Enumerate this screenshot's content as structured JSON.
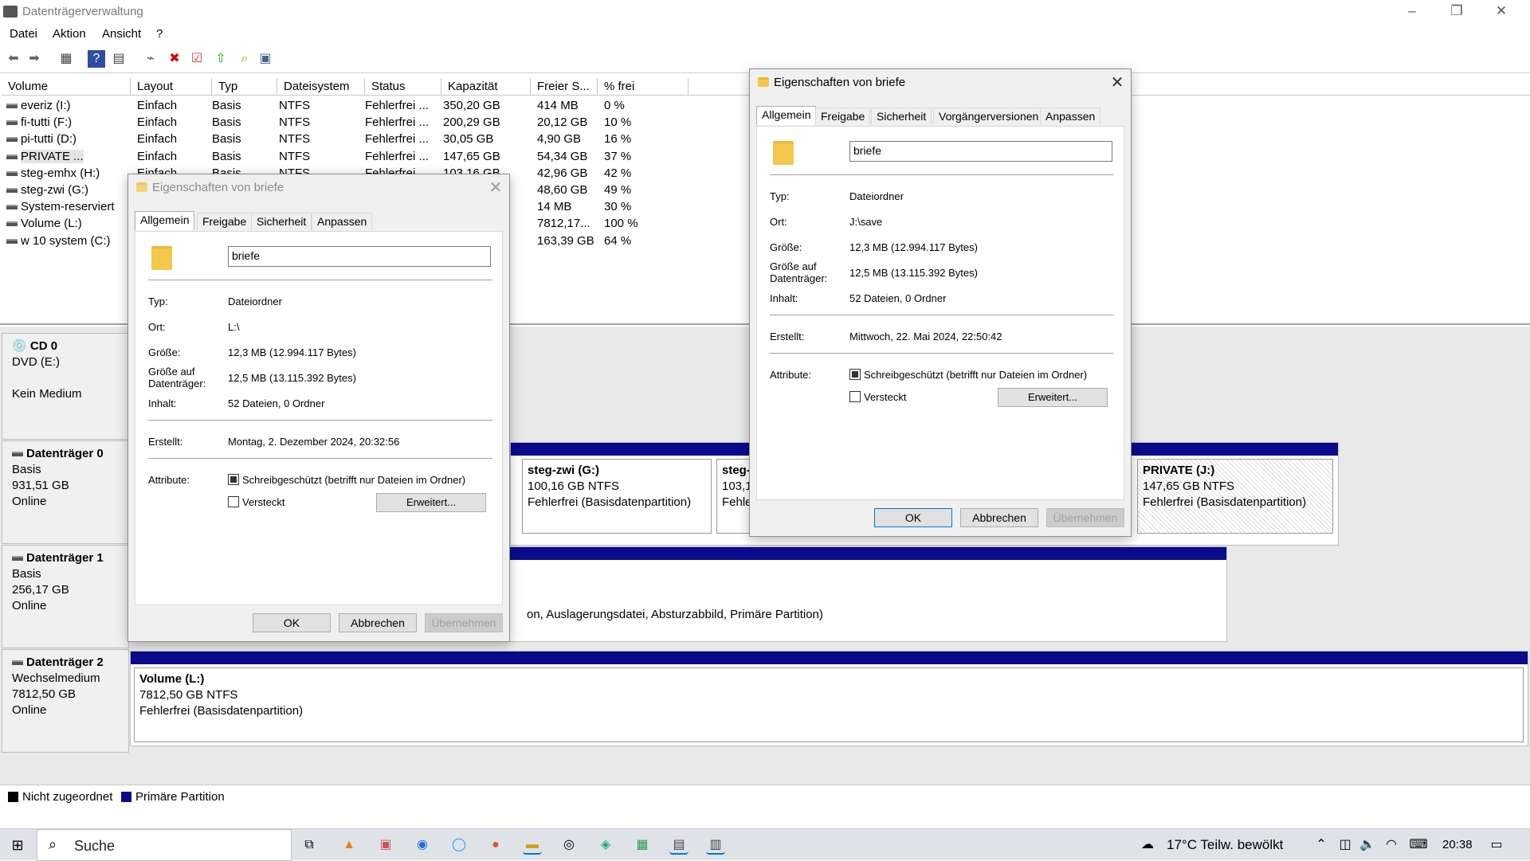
{
  "window": {
    "title": "Datenträgerverwaltung",
    "minimize_icon": "minimize-icon",
    "maximize_icon": "restore-icon",
    "close_icon": "close-icon"
  },
  "menu": [
    "Datei",
    "Aktion",
    "Ansicht",
    "?"
  ],
  "table": {
    "headers": [
      "Volume",
      "Layout",
      "Typ",
      "Dateisystem",
      "Status",
      "Kapazität",
      "Freier S...",
      "% frei"
    ],
    "rows": [
      {
        "volume": "everiz (I:)",
        "layout": "Einfach",
        "typ": "Basis",
        "fs": "NTFS",
        "status": "Fehlerfrei ...",
        "cap": "350,20 GB",
        "free": "414 MB",
        "pct": "0 %"
      },
      {
        "volume": "fi-tutti (F:)",
        "layout": "Einfach",
        "typ": "Basis",
        "fs": "NTFS",
        "status": "Fehlerfrei ...",
        "cap": "200,29 GB",
        "free": "20,12 GB",
        "pct": "10 %"
      },
      {
        "volume": "pi-tutti (D:)",
        "layout": "Einfach",
        "typ": "Basis",
        "fs": "NTFS",
        "status": "Fehlerfrei ...",
        "cap": "30,05 GB",
        "free": "4,90 GB",
        "pct": "16 %"
      },
      {
        "volume": "PRIVATE ...",
        "layout": "Einfach",
        "typ": "Basis",
        "fs": "NTFS",
        "status": "Fehlerfrei ...",
        "cap": "147,65 GB",
        "free": "54,34 GB",
        "pct": "37 %"
      },
      {
        "volume": "steg-emhx (H:)",
        "layout": "Einfach",
        "typ": "Basis",
        "fs": "NTFS",
        "status": "Fehlerfrei ...",
        "cap": "103,16 GB",
        "free": "42,96 GB",
        "pct": "42 %"
      },
      {
        "volume": "steg-zwi (G:)",
        "layout": "",
        "typ": "",
        "fs": "",
        "status": "",
        "cap": "",
        "free": "48,60 GB",
        "pct": "49 %"
      },
      {
        "volume": "System-reserviert",
        "layout": "",
        "typ": "",
        "fs": "",
        "status": "",
        "cap": "",
        "free": "14 MB",
        "pct": "30 %"
      },
      {
        "volume": "Volume (L:)",
        "layout": "",
        "typ": "",
        "fs": "",
        "status": "",
        "cap": "",
        "free": "7812,17...",
        "pct": "100 %"
      },
      {
        "volume": "w 10 system (C:)",
        "layout": "",
        "typ": "",
        "fs": "",
        "status": "",
        "cap": "",
        "free": "163,39 GB",
        "pct": "64 %"
      }
    ]
  },
  "disks": [
    {
      "name": "CD 0",
      "line1": "DVD (E:)",
      "line2": "",
      "line3": "Kein Medium"
    },
    {
      "name": "Datenträger 0",
      "line1": "Basis",
      "line2": "931,51 GB",
      "line3": "Online"
    },
    {
      "name": "Datenträger 1",
      "line1": "Basis",
      "line2": "256,17 GB",
      "line3": "Online"
    },
    {
      "name": "Datenträger 2",
      "line1": "Wechselmedium",
      "line2": "7812,50 GB",
      "line3": "Online"
    }
  ],
  "partitions": {
    "g": {
      "title": "steg-zwi  (G:)",
      "size": "100,16 GB NTFS",
      "status": "Fehlerfrei (Basisdatenpartition)"
    },
    "h": {
      "title": "steg-",
      "size": "103,1",
      "status": "Fehle"
    },
    "j": {
      "title": "PRIVATE  (J:)",
      "size": "147,65 GB NTFS",
      "status": "Fehlerfrei (Basisdatenpartition)"
    },
    "disk1_text": "on, Auslagerungsdatei, Absturzabbild, Primäre Partition)",
    "l": {
      "title": "Volume  (L:)",
      "size": "7812,50 GB NTFS",
      "status": "Fehlerfrei (Basisdatenpartition)"
    }
  },
  "legend": {
    "unallocated": "Nicht zugeordnet",
    "primary": "Primäre Partition",
    "unallocated_color": "#000000",
    "primary_color": "#0a0a8c"
  },
  "dialog_left": {
    "title": "Eigenschaften von briefe",
    "tabs": [
      "Allgemein",
      "Freigabe",
      "Sicherheit",
      "Anpassen"
    ],
    "name": "briefe",
    "typ_label": "Typ:",
    "typ": "Dateiordner",
    "ort_label": "Ort:",
    "ort": "L:\\",
    "groesse_label": "Größe:",
    "groesse": "12,3 MB (12.994.117 Bytes)",
    "gad_label": "Größe auf Datenträger:",
    "gad": "12,5 MB (13.115.392 Bytes)",
    "inhalt_label": "Inhalt:",
    "inhalt": "52 Dateien, 0 Ordner",
    "erstellt_label": "Erstellt:",
    "erstellt": "Montag, 2. Dezember 2024, 20:32:56",
    "attr_label": "Attribute:",
    "readonly": "Schreibgeschützt (betrifft nur Dateien im Ordner)",
    "hidden": "Versteckt",
    "advanced": "Erweitert...",
    "ok": "OK",
    "cancel": "Abbrechen",
    "apply": "Übernehmen"
  },
  "dialog_right": {
    "title": "Eigenschaften von briefe",
    "tabs": [
      "Allgemein",
      "Freigabe",
      "Sicherheit",
      "Vorgängerversionen",
      "Anpassen"
    ],
    "name": "briefe",
    "typ_label": "Typ:",
    "typ": "Dateiordner",
    "ort_label": "Ort:",
    "ort": "J:\\save",
    "groesse_label": "Größe:",
    "groesse": "12,3 MB (12.994.117 Bytes)",
    "gad_label": "Größe auf Datenträger:",
    "gad": "12,5 MB (13.115.392 Bytes)",
    "inhalt_label": "Inhalt:",
    "inhalt": "52 Dateien, 0 Ordner",
    "erstellt_label": "Erstellt:",
    "erstellt": "Mittwoch, 22. Mai 2024, 22:50:42",
    "attr_label": "Attribute:",
    "readonly": "Schreibgeschützt (betrifft nur Dateien im Ordner)",
    "hidden": "Versteckt",
    "advanced": "Erweitert...",
    "ok": "OK",
    "cancel": "Abbrechen",
    "apply": "Übernehmen"
  },
  "taskbar": {
    "search_placeholder": "Suche",
    "weather": "17°C  Teilw. bewölkt",
    "time": "20:38"
  }
}
